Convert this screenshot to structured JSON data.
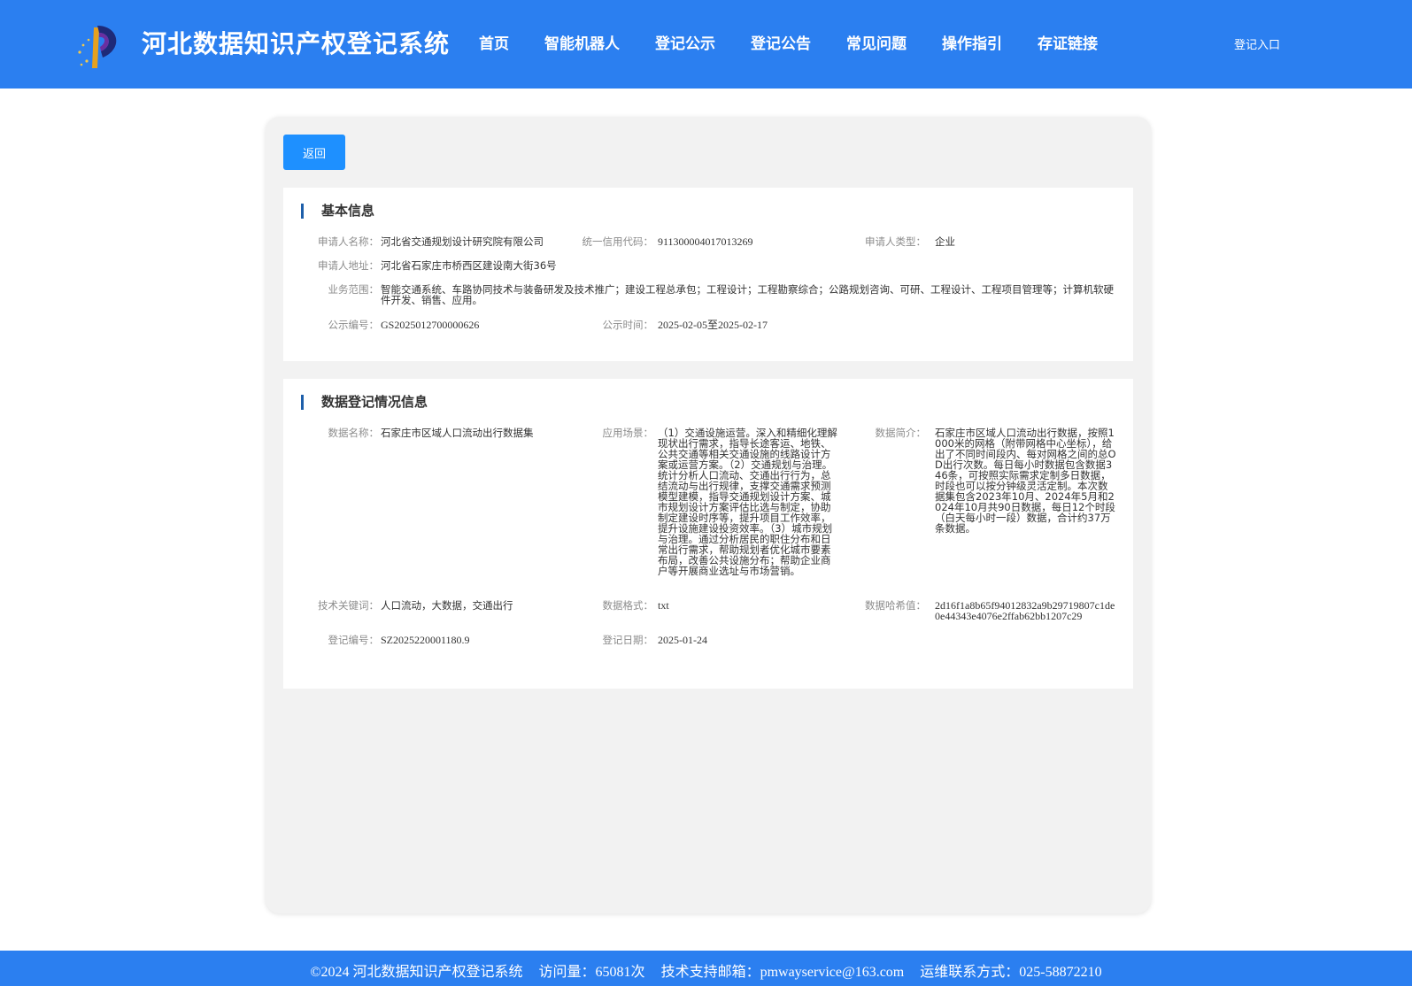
{
  "header": {
    "site_title": "河北数据知识产权登记系统",
    "nav": [
      "首页",
      "智能机器人",
      "登记公示",
      "登记公告",
      "常见问题",
      "操作指引",
      "存证链接"
    ],
    "login_label": "登记入口"
  },
  "main": {
    "back_label": "返回",
    "basic_info": {
      "title": "基本信息",
      "applicant_name": {
        "label": "申请人名称：",
        "value": "河北省交通规划设计研究院有限公司"
      },
      "credit_code": {
        "label": "统一信用代码：",
        "value": "911300004017013269"
      },
      "applicant_type": {
        "label": "申请人类型：",
        "value": "企业"
      },
      "address": {
        "label": "申请人地址：",
        "value": "河北省石家庄市桥西区建设南大街36号"
      },
      "business_scope": {
        "label": "业务范围：",
        "value": "智能交通系统、车路协同技术与装备研发及技术推广；建设工程总承包；工程设计；工程勘察综合；公路规划咨询、可研、工程设计、工程项目管理等；计算机软硬件开发、销售、应用。"
      },
      "notice_no": {
        "label": "公示编号：",
        "value": "GS2025012700000626"
      },
      "notice_time": {
        "label": "公示时间：",
        "value": "2025-02-05至2025-02-17"
      }
    },
    "data_info": {
      "title": "数据登记情况信息",
      "data_name": {
        "label": "数据名称：",
        "value": "石家庄市区域人口流动出行数据集"
      },
      "scenario": {
        "label": "应用场景：",
        "value": "（1）交通设施运营。深入和精细化理解现状出行需求，指导长途客运、地铁、公共交通等相关交通设施的线路设计方案或运营方案。（2）交通规划与治理。统计分析人口流动、交通出行行为，总结流动与出行规律，支撑交通需求预测模型建模，指导交通规划设计方案、城市规划设计方案评估比选与制定，协助制定建设时序等，提升项目工作效率，提升设施建设投资效率。（3）城市规划与治理。通过分析居民的职住分布和日常出行需求，帮助规划者优化城市要素布局，改善公共设施分布；帮助企业商户等开展商业选址与市场营销。"
      },
      "summary": {
        "label": "数据简介：",
        "value": "石家庄市区域人口流动出行数据，按照1000米的网格（附带网格中心坐标），给出了不同时间段内、每对网格之间的总OD出行次数。每日每小时数据包含数据346条，可按照实际需求定制多日数据，时段也可以按分钟级灵活定制。本次数据集包含2023年10月、2024年5月和2024年10月共90日数据，每日12个时段（白天每小时一段）数据，合计约37万条数据。"
      },
      "keywords": {
        "label": "技术关键词：",
        "value": "人口流动，大数据，交通出行"
      },
      "format": {
        "label": "数据格式：",
        "value": "txt"
      },
      "hash": {
        "label": "数据哈希值：",
        "value": "2d16f1a8b65f94012832a9b29719807c1de0e44343e4076e2ffab62bb1207c29"
      },
      "reg_no": {
        "label": "登记编号：",
        "value": "SZ2025220001180.9"
      },
      "reg_date": {
        "label": "登记日期：",
        "value": "2025-01-24"
      }
    }
  },
  "footer": {
    "copyright": "©2024 河北数据知识产权登记系统",
    "visits": "访问量：65081次",
    "email": "技术支持邮箱：pmwayservice@163.com",
    "phone": "运维联系方式：025-58872210"
  },
  "colors": {
    "brand": "#2b7ff0",
    "button": "#1e90ff",
    "accent_bar": "#1e5faa"
  },
  "icons": {
    "logo": "system-logo-icon"
  }
}
